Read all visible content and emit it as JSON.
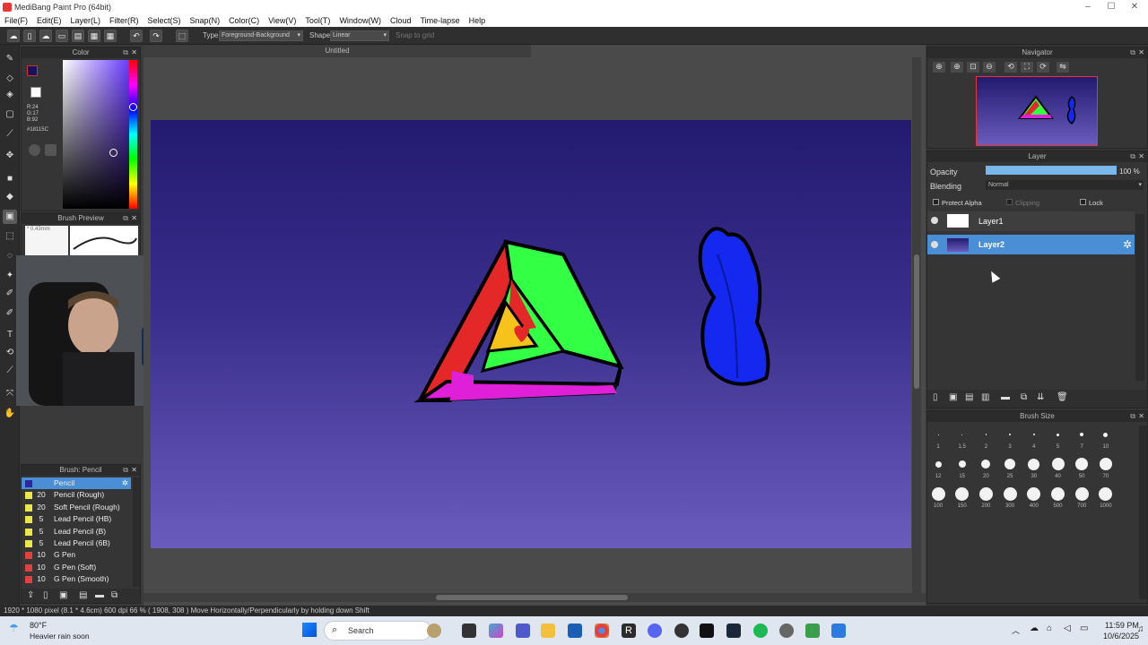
{
  "window": {
    "title": "MediBang Paint Pro (64bit)",
    "minimize": "–",
    "maximize": "☐",
    "close": "✕"
  },
  "menu": [
    "File(F)",
    "Edit(E)",
    "Layer(L)",
    "Filter(R)",
    "Select(S)",
    "Snap(N)",
    "Color(C)",
    "View(V)",
    "Tool(T)",
    "Window(W)",
    "Cloud",
    "Time-lapse",
    "Help"
  ],
  "toolbar": {
    "type_label": "Type",
    "type_value": "Foreground-Background",
    "shape_label": "Shape",
    "shape_value": "Linear",
    "snap_label": "Snap to grid"
  },
  "color_panel": {
    "title": "Color",
    "r": "R:24",
    "g": "G:17",
    "b": "B:92",
    "hex": "#18115C",
    "fg_color": "#18115c",
    "bg_color": "#ffffff"
  },
  "brush_preview": {
    "title": "Brush Preview",
    "size": "0.43mm"
  },
  "brush_panel": {
    "title": "Brush: Pencil",
    "items": [
      {
        "size": "",
        "name": "Pencil",
        "color": "#2a2a9a",
        "selected": true
      },
      {
        "size": "20",
        "name": "Pencil (Rough)",
        "color": "#e8e84a"
      },
      {
        "size": "20",
        "name": "Soft Pencil (Rough)",
        "color": "#e8e84a"
      },
      {
        "size": "5",
        "name": "Lead Pencil (HB)",
        "color": "#e8e84a"
      },
      {
        "size": "5",
        "name": "Lead Pencil (B)",
        "color": "#e8e84a"
      },
      {
        "size": "5",
        "name": "Lead Pencil (6B)",
        "color": "#e8e84a"
      },
      {
        "size": "10",
        "name": "G Pen",
        "color": "#e04040"
      },
      {
        "size": "10",
        "name": "G Pen (Soft)",
        "color": "#e04040"
      },
      {
        "size": "10",
        "name": "G Pen (Smooth)",
        "color": "#e04040"
      }
    ]
  },
  "canvas": {
    "tab": "Untitled"
  },
  "navigator": {
    "title": "Navigator"
  },
  "layer_panel": {
    "title": "Layer",
    "opacity_label": "Opacity",
    "opacity_value": "100 %",
    "opacity_fraction": 1.0,
    "blending_label": "Blending",
    "blending_value": "Normal",
    "protect_alpha": "Protect Alpha",
    "clipping": "Clipping",
    "lock": "Lock",
    "layers": [
      {
        "name": "Layer1",
        "selected": false
      },
      {
        "name": "Layer2",
        "selected": true
      }
    ]
  },
  "brush_size": {
    "title": "Brush Size",
    "row1": [
      "1",
      "1.5",
      "2",
      "3",
      "4",
      "5",
      "7",
      "10"
    ],
    "row2": [
      "12",
      "15",
      "20",
      "25",
      "30",
      "40",
      "50",
      "70"
    ],
    "row3": [
      "100",
      "150",
      "200",
      "300",
      "400",
      "500",
      "700",
      "1000"
    ]
  },
  "status": {
    "text": "1920 * 1080 pixel   (8.1 * 4.6cm)   600 dpi   66 %   ( 1908, 308 )   Move Horizontally/Perpendicularly by holding down Shift"
  },
  "taskbar": {
    "temp": "80°F",
    "weather": "Heavier rain soon",
    "search": "Search",
    "time": "11:59 PM",
    "date": "10/6/2025"
  }
}
